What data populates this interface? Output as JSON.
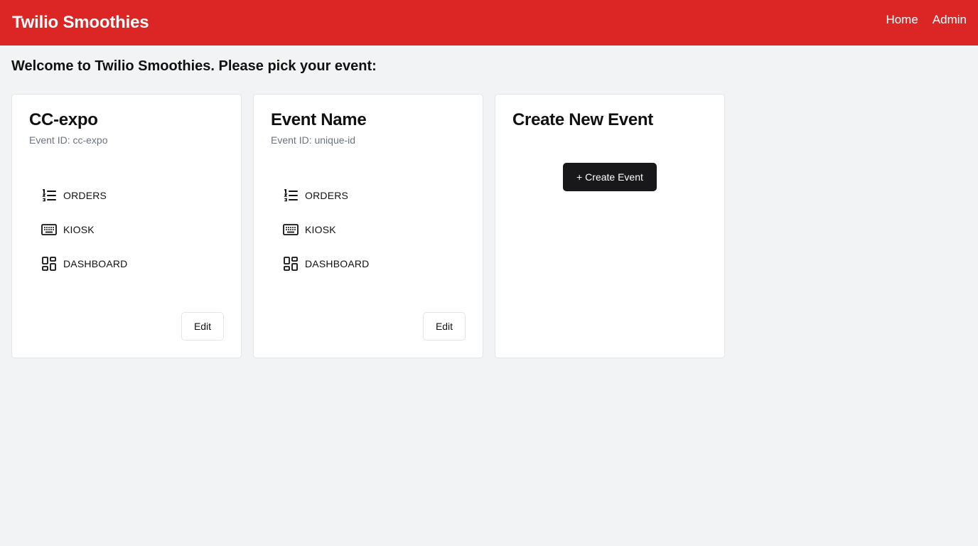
{
  "header": {
    "title": "Twilio Smoothies",
    "nav": [
      {
        "label": "Home"
      },
      {
        "label": "Admin"
      }
    ]
  },
  "welcome": "Welcome to Twilio Smoothies. Please pick your event:",
  "events": [
    {
      "name": "CC-expo",
      "event_id": "Event ID: cc-expo",
      "links": [
        {
          "label": "ORDERS",
          "icon": "list-ordered-icon"
        },
        {
          "label": "KIOSK",
          "icon": "keyboard-icon"
        },
        {
          "label": "DASHBOARD",
          "icon": "dashboard-icon"
        }
      ],
      "edit_label": "Edit"
    },
    {
      "name": "Event Name",
      "event_id": "Event ID: unique-id",
      "links": [
        {
          "label": "ORDERS",
          "icon": "list-ordered-icon"
        },
        {
          "label": "KIOSK",
          "icon": "keyboard-icon"
        },
        {
          "label": "DASHBOARD",
          "icon": "dashboard-icon"
        }
      ],
      "edit_label": "Edit"
    }
  ],
  "create_card": {
    "title": "Create New Event",
    "button_label": "+ Create Event"
  },
  "colors": {
    "header_bg": "#dc2626",
    "page_bg": "#f2f3f5",
    "primary_button_bg": "#18181b"
  }
}
